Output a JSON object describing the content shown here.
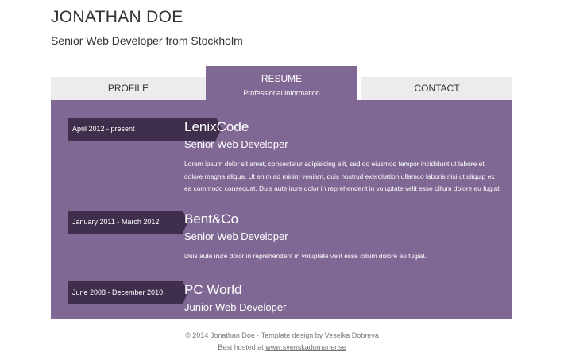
{
  "header": {
    "name": "JONATHAN DOE",
    "tagline": "Senior Web Developer from Stockholm"
  },
  "tabs": {
    "profile": {
      "label": "PROFILE"
    },
    "resume": {
      "label": "RESUME",
      "subtitle": "Professional information",
      "active": true
    },
    "contact": {
      "label": "CONTACT"
    }
  },
  "resume": {
    "entries": [
      {
        "dates": "April 2012 - present",
        "company": "LenixCode",
        "role": "Senior Web Developer",
        "description": "Lorem ipsum dolor sit amet, consectetur adipisicing elit, sed do eiusmod tempor incididunt ut labore et dolore magna aliqua. Ut enim ad minim veniam, quis nostrud exercitation ullamco laboris nisi ut aliquip ex ea commodo consequat. Duis aute irure dolor in reprehenderit in voluptate velit esse cillum dolore eu fugiat."
      },
      {
        "dates": "January 2011 - March 2012",
        "company": "Bent&Co",
        "role": "Senior Web Developer",
        "description": "Duis aute irure dolor in reprehenderit in voluptate velit esse cillum dolore eu fugiat."
      },
      {
        "dates": "June 2008 - December 2010",
        "company": "PC World",
        "role": "Junior Web Developer",
        "description": ""
      }
    ]
  },
  "footer": {
    "copyright": "© 2014 Jonathan Doe · ",
    "template_link": "Template design",
    "by": " by ",
    "author_link": "Veselka Dobreva",
    "hosted_prefix": "Best hosted at ",
    "host_link": "www.svenskadomaner.se"
  },
  "colors": {
    "accent": "#7f6894",
    "badge": "#3f2f4c",
    "tab_inactive": "#ececec"
  }
}
